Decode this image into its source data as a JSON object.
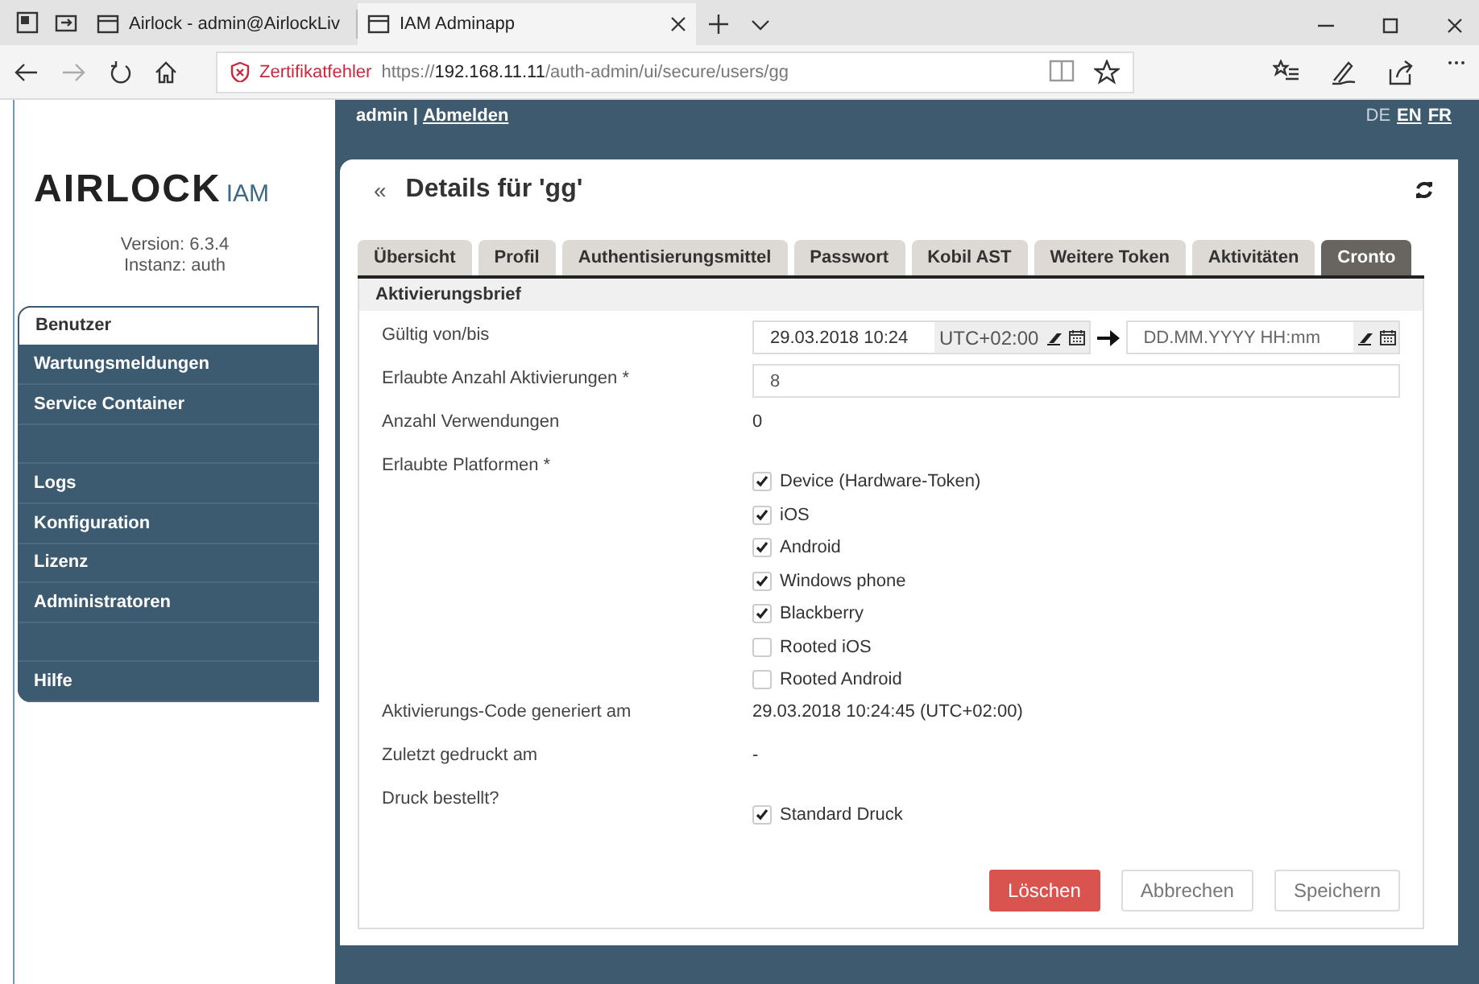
{
  "browser": {
    "tabs": [
      {
        "title": "Airlock - admin@AirlockLiv",
        "selected": false
      },
      {
        "title": "IAM Adminapp",
        "selected": true
      }
    ],
    "address": {
      "warning": "Zertifikatfehler",
      "scheme": "https://",
      "host": "192.168.11.11",
      "path": "/auth-admin/ui/secure/users/gg"
    }
  },
  "header": {
    "user": "admin",
    "separator": "|",
    "logout": "Abmelden",
    "languages": [
      {
        "code": "DE",
        "selected": true
      },
      {
        "code": "EN",
        "selected": false
      },
      {
        "code": "FR",
        "selected": false
      }
    ]
  },
  "sidebar": {
    "logo": {
      "main": "AIRLOCK",
      "sub": "IAM"
    },
    "version": "Version: 6.3.4",
    "instance": "Instanz: auth",
    "items": [
      {
        "kind": "item",
        "label": "Benutzer",
        "selected": true
      },
      {
        "kind": "item",
        "label": "Wartungsmeldungen",
        "selected": false
      },
      {
        "kind": "item",
        "label": "Service Container",
        "selected": false
      },
      {
        "kind": "spacer"
      },
      {
        "kind": "item",
        "label": "Logs",
        "selected": false
      },
      {
        "kind": "item",
        "label": "Konfiguration",
        "selected": false
      },
      {
        "kind": "item",
        "label": "Lizenz",
        "selected": false
      },
      {
        "kind": "item",
        "label": "Administratoren",
        "selected": false
      },
      {
        "kind": "spacer"
      },
      {
        "kind": "item",
        "label": "Hilfe",
        "selected": false
      }
    ]
  },
  "page": {
    "back": "«",
    "title": "Details für 'gg'",
    "tabs": [
      {
        "label": "Übersicht",
        "selected": false
      },
      {
        "label": "Profil",
        "selected": false
      },
      {
        "label": "Authentisierungsmittel",
        "selected": false
      },
      {
        "label": "Passwort",
        "selected": false
      },
      {
        "label": "Kobil AST",
        "selected": false
      },
      {
        "label": "Weitere Token",
        "selected": false
      },
      {
        "label": "Aktivitäten",
        "selected": false
      },
      {
        "label": "Cronto",
        "selected": true
      }
    ],
    "section": "Aktivierungsbrief",
    "fields": [
      {
        "kind": "daterange",
        "label": "Gültig von/bis",
        "from": {
          "value": "29.03.2018 10:24",
          "timezone": "UTC+02:00"
        },
        "to": {
          "placeholder": "DD.MM.YYYY HH:mm"
        }
      },
      {
        "kind": "input",
        "label": "Erlaubte Anzahl Aktivierungen *",
        "value": "8"
      },
      {
        "kind": "text",
        "label": "Anzahl Verwendungen",
        "value": "0"
      },
      {
        "kind": "checkboxes",
        "label": "Erlaubte Platformen *",
        "options": [
          {
            "label": "Device (Hardware-Token)",
            "checked": true
          },
          {
            "label": "iOS",
            "checked": true
          },
          {
            "label": "Android",
            "checked": true
          },
          {
            "label": "Windows phone",
            "checked": true
          },
          {
            "label": "Blackberry",
            "checked": true
          },
          {
            "label": "Rooted iOS",
            "checked": false
          },
          {
            "label": "Rooted Android",
            "checked": false
          }
        ]
      },
      {
        "kind": "text",
        "label": "Aktivierungs-Code generiert am",
        "value": "29.03.2018 10:24:45 (UTC+02:00)"
      },
      {
        "kind": "text",
        "label": "Zuletzt gedruckt am",
        "value": "-"
      },
      {
        "kind": "checkboxes",
        "label": "Druck bestellt?",
        "options": [
          {
            "label": "Standard Druck",
            "checked": true
          }
        ]
      }
    ],
    "buttons": [
      {
        "label": "Löschen",
        "kind": "danger"
      },
      {
        "label": "Abbrechen",
        "kind": "default"
      },
      {
        "label": "Speichern",
        "kind": "default"
      }
    ]
  }
}
